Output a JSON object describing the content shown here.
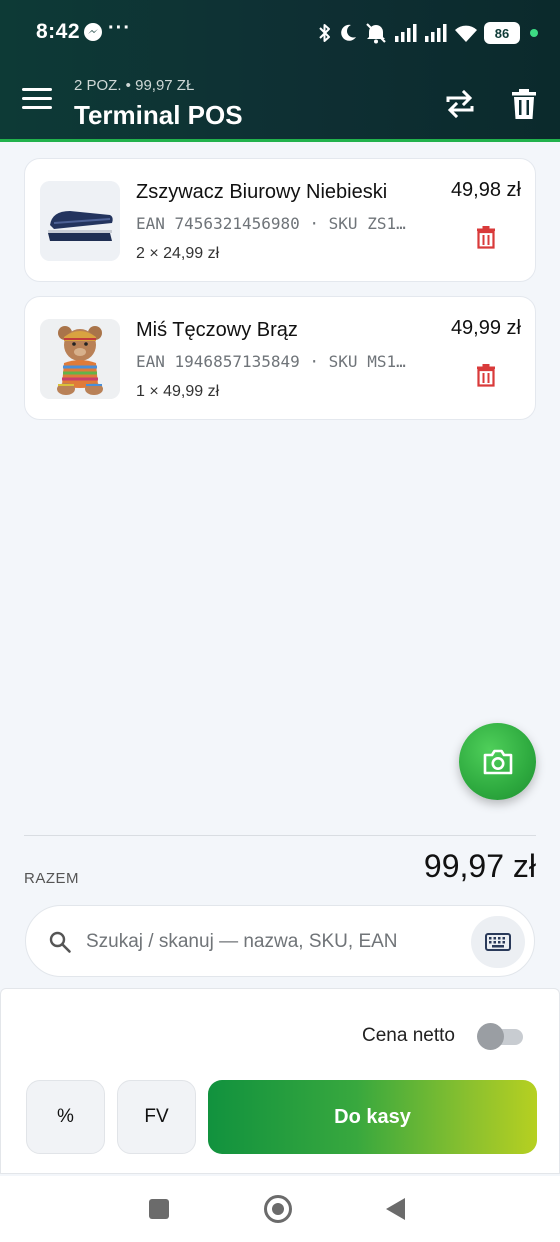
{
  "status_bar": {
    "time": "8:42",
    "dots": "···",
    "battery": "86"
  },
  "app_bar": {
    "subtitle": "2 POZ. • 99,97 ZŁ",
    "title": "Terminal POS"
  },
  "cart": {
    "items": [
      {
        "name": "Zszywacz Biurowy Niebieski",
        "codes": "EAN 7456321456980 · SKU ZS1…",
        "qty": "2 × 24,99 zł",
        "price": "49,98 zł"
      },
      {
        "name": "Miś Tęczowy Brąz",
        "codes": "EAN 1946857135849 · SKU MS1…",
        "qty": "1 × 49,99 zł",
        "price": "49,99 zł"
      }
    ]
  },
  "totals": {
    "label": "RAZEM",
    "value": "99,97 zł"
  },
  "search": {
    "placeholder": "Szukaj / skanuj — nazwa, SKU, EAN"
  },
  "bottom": {
    "netto_label": "Cena netto",
    "netto_enabled": false,
    "discount_label": "%",
    "invoice_label": "FV",
    "checkout_label": "Do kasy"
  },
  "colors": {
    "header_bg": "#0d3a36",
    "accent_green": "#22b24c",
    "delete_red": "#d93a3a"
  }
}
